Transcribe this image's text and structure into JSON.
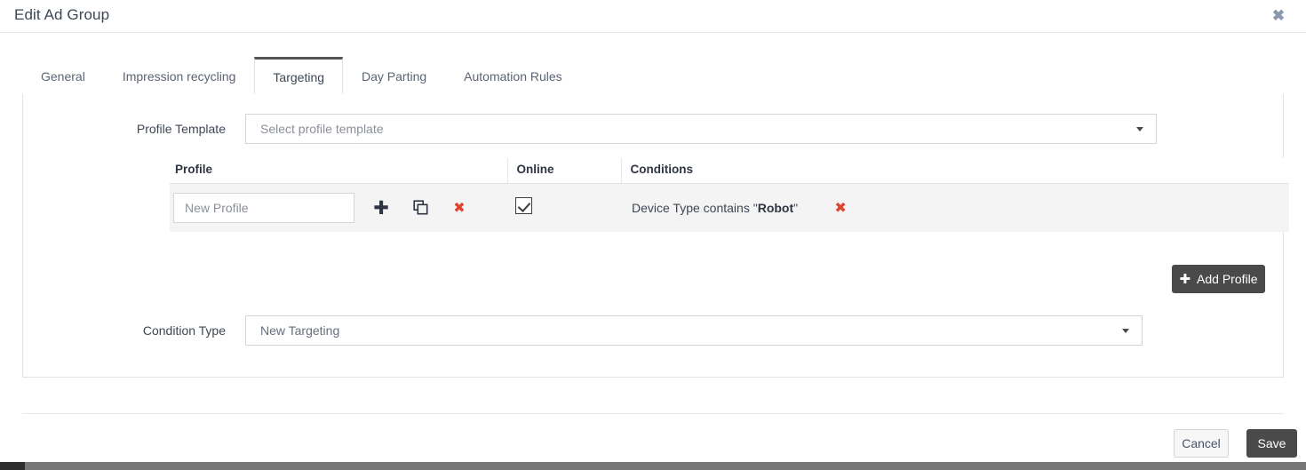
{
  "header": {
    "title": "Edit Ad Group",
    "close_label": "✖"
  },
  "tabs": [
    {
      "label": "General",
      "active": false
    },
    {
      "label": "Impression recycling",
      "active": false
    },
    {
      "label": "Targeting",
      "active": true
    },
    {
      "label": "Day Parting",
      "active": false
    },
    {
      "label": "Automation Rules",
      "active": false
    }
  ],
  "targeting": {
    "profile_template": {
      "label": "Profile Template",
      "placeholder": "Select profile template",
      "value": ""
    },
    "table": {
      "headers": {
        "profile": "Profile",
        "online": "Online",
        "conditions": "Conditions"
      },
      "rows": [
        {
          "profile_name": "",
          "profile_placeholder": "New Profile",
          "online_checked": true,
          "condition_prefix": "Device Type contains ",
          "condition_quote_open": "\"",
          "condition_value": "Robot",
          "condition_quote_close": "\"",
          "add_icon": "✚",
          "copy_icon": "copy-icon",
          "delete_icon": "✖",
          "condition_delete_icon": "✖"
        }
      ]
    },
    "add_profile": {
      "icon": "✚",
      "label": "Add Profile"
    },
    "condition_type": {
      "label": "Condition Type",
      "value": "New Targeting"
    }
  },
  "footer": {
    "cancel_label": "Cancel",
    "save_label": "Save"
  },
  "colors": {
    "accent_dark": "#4a4a4a",
    "danger_red": "#e0432f",
    "text": "#3e4756",
    "row_bg": "#f4f4f4",
    "border": "#e2e2e2"
  }
}
